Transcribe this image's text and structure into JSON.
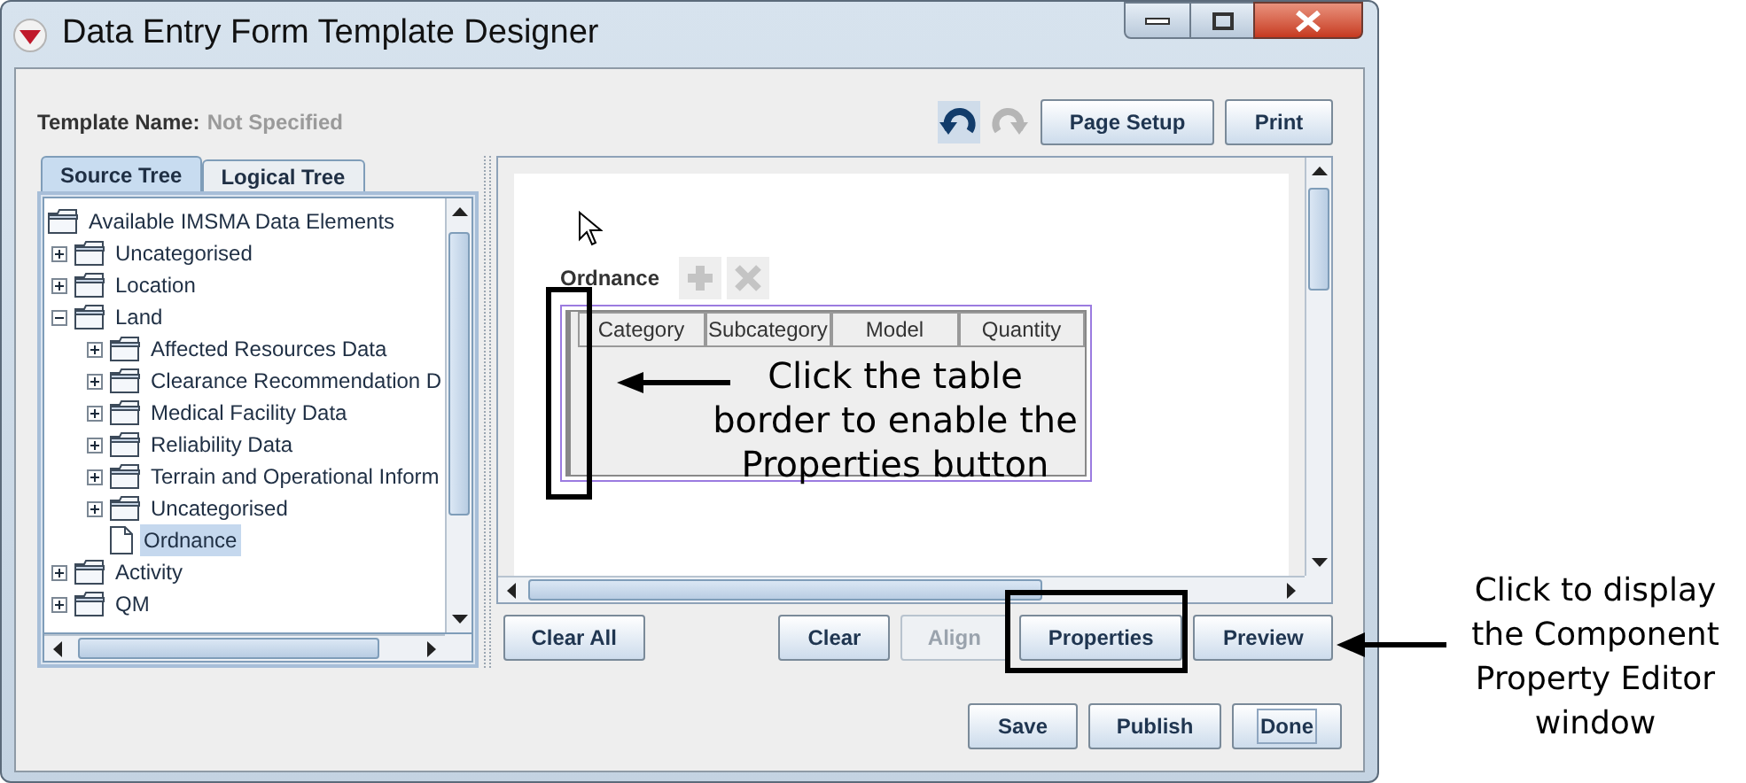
{
  "window": {
    "title": "Data Entry Form Template Designer"
  },
  "template_name": {
    "label": "Template Name:",
    "value": "Not Specified"
  },
  "toolbar": {
    "undo": {
      "disabled": false
    },
    "redo": {
      "disabled": true
    },
    "buttons": [
      {
        "label": "Page Setup",
        "disabled": false
      },
      {
        "label": "Print",
        "disabled": false
      }
    ]
  },
  "tabs": [
    {
      "label": "Source Tree",
      "selected": true
    },
    {
      "label": "Logical Tree",
      "selected": false
    }
  ],
  "tree": [
    {
      "label": "Available IMSMA Data Elements",
      "selected": false,
      "children": [
        {
          "label": "Uncategorised",
          "kind": "folder",
          "expanded": false,
          "selected": false
        },
        {
          "label": "Location",
          "kind": "folder",
          "expanded": false,
          "selected": false
        },
        {
          "label": "Land",
          "kind": "folder",
          "expanded": true,
          "selected": false,
          "children": [
            {
              "label": "Affected Resources Data",
              "kind": "folder",
              "expanded": false,
              "selected": false
            },
            {
              "label": "Clearance Recommendation D",
              "kind": "folder",
              "expanded": false,
              "selected": false
            },
            {
              "label": "Medical Facility Data",
              "kind": "folder",
              "expanded": false,
              "selected": false
            },
            {
              "label": "Reliability Data",
              "kind": "folder",
              "expanded": false,
              "selected": false
            },
            {
              "label": "Terrain and Operational Inform",
              "kind": "folder",
              "expanded": false,
              "selected": false
            },
            {
              "label": "Uncategorised",
              "kind": "folder",
              "expanded": false,
              "selected": false
            },
            {
              "label": "Ordnance",
              "kind": "element",
              "selected": true
            }
          ]
        },
        {
          "label": "Activity",
          "kind": "folder",
          "expanded": false,
          "selected": false
        },
        {
          "label": "QM",
          "kind": "folder",
          "expanded": false,
          "selected": false
        }
      ]
    }
  ],
  "form": {
    "field_label": "Ordnance",
    "add": {
      "disabled": true
    },
    "remove": {
      "disabled": true
    },
    "columns": [
      "Category",
      "Subcategory",
      "Model",
      "Quantity"
    ]
  },
  "canvas_buttons": [
    {
      "label": "Clear All",
      "disabled": false
    },
    {
      "label": "Clear",
      "disabled": false
    },
    {
      "label": "Align",
      "disabled": true
    },
    {
      "label": "Properties",
      "disabled": false
    },
    {
      "label": "Preview",
      "disabled": false
    }
  ],
  "footer_buttons": [
    {
      "label": "Save",
      "focused": false
    },
    {
      "label": "Publish",
      "focused": false
    },
    {
      "label": "Done",
      "focused": true
    }
  ],
  "annotations": {
    "table_note": "Click the table border to enable the Properties button",
    "side_note": "Click to display the Component Property Editor window"
  }
}
